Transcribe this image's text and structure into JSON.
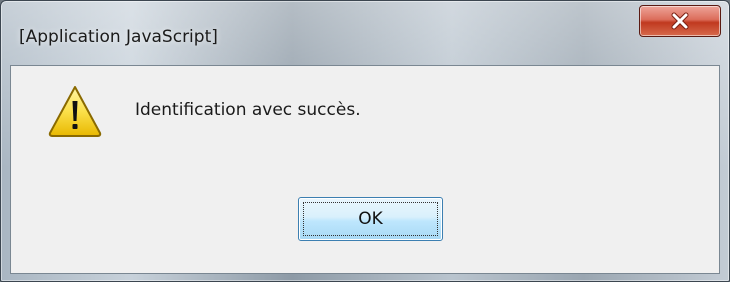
{
  "window": {
    "title": "[Application JavaScript]"
  },
  "titlebar": {
    "close_icon": "close-x-icon"
  },
  "dialog": {
    "icon": "warning-icon",
    "message": "Identification avec succès.",
    "ok_label": "OK"
  }
}
